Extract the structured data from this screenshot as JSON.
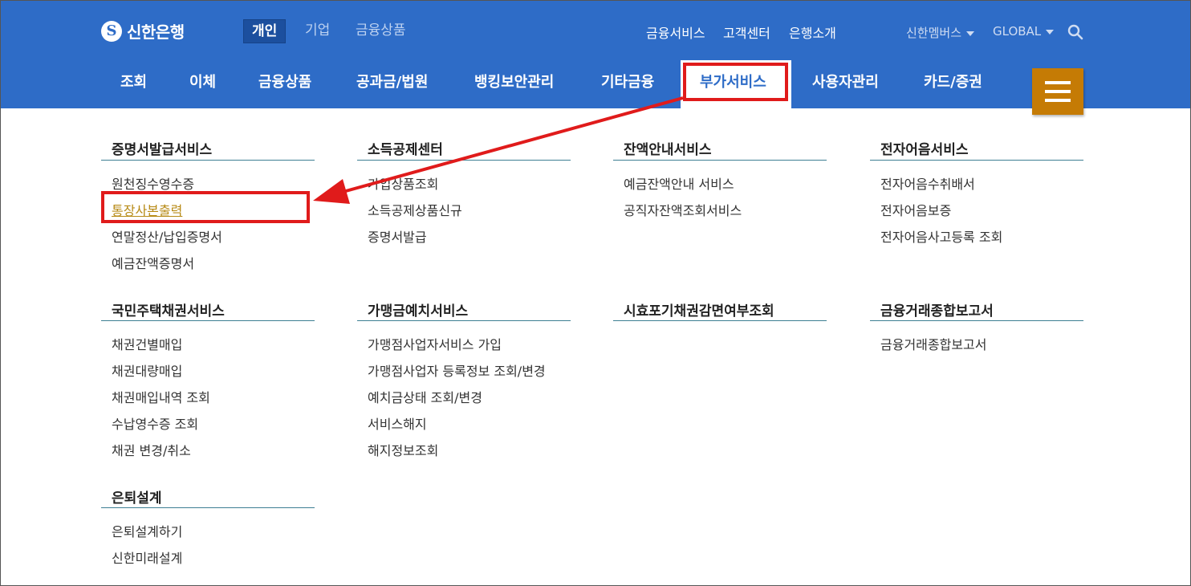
{
  "brand": {
    "name": "신한은행"
  },
  "segments": [
    {
      "label": "개인",
      "active": true
    },
    {
      "label": "기업",
      "active": false
    },
    {
      "label": "금융상품",
      "active": false
    }
  ],
  "util_links": [
    "금융서비스",
    "고객센터",
    "은행소개"
  ],
  "util_dropdowns": [
    "신한멤버스",
    "GLOBAL"
  ],
  "gnb": [
    "조회",
    "이체",
    "금융상품",
    "공과금/법원",
    "뱅킹보안관리",
    "기타금융",
    "부가서비스",
    "사용자관리",
    "카드/증권"
  ],
  "gnb_active": "부가서비스",
  "columns": [
    {
      "title": "증명서발급서비스",
      "items": [
        "원천징수영수증",
        "통장사본출력",
        "연말정산/납입증명서",
        "예금잔액증명서"
      ]
    },
    {
      "title": "소득공제센터",
      "items": [
        "가입상품조회",
        "소득공제상품신규",
        "증명서발급"
      ]
    },
    {
      "title": "잔액안내서비스",
      "items": [
        "예금잔액안내 서비스",
        "공직자잔액조회서비스"
      ]
    },
    {
      "title": "전자어음서비스",
      "items": [
        "전자어음수취배서",
        "전자어음보증",
        "전자어음사고등록 조회"
      ]
    },
    {
      "title": "국민주택채권서비스",
      "items": [
        "채권건별매입",
        "채권대량매입",
        "채권매입내역 조회",
        "수납영수증 조회",
        "채권 변경/취소"
      ]
    },
    {
      "title": "가맹금예치서비스",
      "items": [
        "가맹점사업자서비스 가입",
        "가맹점사업자 등록정보 조회/변경",
        "예치금상태 조회/변경",
        "서비스해지",
        "해지정보조회"
      ]
    },
    {
      "title": "시효포기채권감면여부조회",
      "items": []
    },
    {
      "title": "금융거래종합보고서",
      "items": [
        "금융거래종합보고서"
      ]
    },
    {
      "title": "은퇴설계",
      "items": [
        "은퇴설계하기",
        "신한미래설계"
      ]
    }
  ],
  "selected_item": "통장사본출력",
  "colors": {
    "header": "#2e6cc7",
    "highlight": "#e01b1b",
    "menu_button": "#c57b05",
    "selected_link": "#b78a16"
  }
}
